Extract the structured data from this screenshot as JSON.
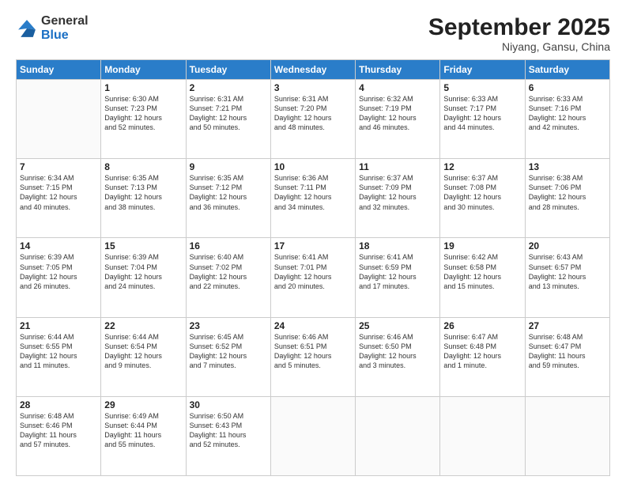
{
  "header": {
    "logo": {
      "line1": "General",
      "line2": "Blue"
    },
    "title": "September 2025",
    "location": "Niyang, Gansu, China"
  },
  "weekdays": [
    "Sunday",
    "Monday",
    "Tuesday",
    "Wednesday",
    "Thursday",
    "Friday",
    "Saturday"
  ],
  "weeks": [
    [
      {
        "day": "",
        "info": ""
      },
      {
        "day": "1",
        "info": "Sunrise: 6:30 AM\nSunset: 7:23 PM\nDaylight: 12 hours\nand 52 minutes."
      },
      {
        "day": "2",
        "info": "Sunrise: 6:31 AM\nSunset: 7:21 PM\nDaylight: 12 hours\nand 50 minutes."
      },
      {
        "day": "3",
        "info": "Sunrise: 6:31 AM\nSunset: 7:20 PM\nDaylight: 12 hours\nand 48 minutes."
      },
      {
        "day": "4",
        "info": "Sunrise: 6:32 AM\nSunset: 7:19 PM\nDaylight: 12 hours\nand 46 minutes."
      },
      {
        "day": "5",
        "info": "Sunrise: 6:33 AM\nSunset: 7:17 PM\nDaylight: 12 hours\nand 44 minutes."
      },
      {
        "day": "6",
        "info": "Sunrise: 6:33 AM\nSunset: 7:16 PM\nDaylight: 12 hours\nand 42 minutes."
      }
    ],
    [
      {
        "day": "7",
        "info": "Sunrise: 6:34 AM\nSunset: 7:15 PM\nDaylight: 12 hours\nand 40 minutes."
      },
      {
        "day": "8",
        "info": "Sunrise: 6:35 AM\nSunset: 7:13 PM\nDaylight: 12 hours\nand 38 minutes."
      },
      {
        "day": "9",
        "info": "Sunrise: 6:35 AM\nSunset: 7:12 PM\nDaylight: 12 hours\nand 36 minutes."
      },
      {
        "day": "10",
        "info": "Sunrise: 6:36 AM\nSunset: 7:11 PM\nDaylight: 12 hours\nand 34 minutes."
      },
      {
        "day": "11",
        "info": "Sunrise: 6:37 AM\nSunset: 7:09 PM\nDaylight: 12 hours\nand 32 minutes."
      },
      {
        "day": "12",
        "info": "Sunrise: 6:37 AM\nSunset: 7:08 PM\nDaylight: 12 hours\nand 30 minutes."
      },
      {
        "day": "13",
        "info": "Sunrise: 6:38 AM\nSunset: 7:06 PM\nDaylight: 12 hours\nand 28 minutes."
      }
    ],
    [
      {
        "day": "14",
        "info": "Sunrise: 6:39 AM\nSunset: 7:05 PM\nDaylight: 12 hours\nand 26 minutes."
      },
      {
        "day": "15",
        "info": "Sunrise: 6:39 AM\nSunset: 7:04 PM\nDaylight: 12 hours\nand 24 minutes."
      },
      {
        "day": "16",
        "info": "Sunrise: 6:40 AM\nSunset: 7:02 PM\nDaylight: 12 hours\nand 22 minutes."
      },
      {
        "day": "17",
        "info": "Sunrise: 6:41 AM\nSunset: 7:01 PM\nDaylight: 12 hours\nand 20 minutes."
      },
      {
        "day": "18",
        "info": "Sunrise: 6:41 AM\nSunset: 6:59 PM\nDaylight: 12 hours\nand 17 minutes."
      },
      {
        "day": "19",
        "info": "Sunrise: 6:42 AM\nSunset: 6:58 PM\nDaylight: 12 hours\nand 15 minutes."
      },
      {
        "day": "20",
        "info": "Sunrise: 6:43 AM\nSunset: 6:57 PM\nDaylight: 12 hours\nand 13 minutes."
      }
    ],
    [
      {
        "day": "21",
        "info": "Sunrise: 6:44 AM\nSunset: 6:55 PM\nDaylight: 12 hours\nand 11 minutes."
      },
      {
        "day": "22",
        "info": "Sunrise: 6:44 AM\nSunset: 6:54 PM\nDaylight: 12 hours\nand 9 minutes."
      },
      {
        "day": "23",
        "info": "Sunrise: 6:45 AM\nSunset: 6:52 PM\nDaylight: 12 hours\nand 7 minutes."
      },
      {
        "day": "24",
        "info": "Sunrise: 6:46 AM\nSunset: 6:51 PM\nDaylight: 12 hours\nand 5 minutes."
      },
      {
        "day": "25",
        "info": "Sunrise: 6:46 AM\nSunset: 6:50 PM\nDaylight: 12 hours\nand 3 minutes."
      },
      {
        "day": "26",
        "info": "Sunrise: 6:47 AM\nSunset: 6:48 PM\nDaylight: 12 hours\nand 1 minute."
      },
      {
        "day": "27",
        "info": "Sunrise: 6:48 AM\nSunset: 6:47 PM\nDaylight: 11 hours\nand 59 minutes."
      }
    ],
    [
      {
        "day": "28",
        "info": "Sunrise: 6:48 AM\nSunset: 6:46 PM\nDaylight: 11 hours\nand 57 minutes."
      },
      {
        "day": "29",
        "info": "Sunrise: 6:49 AM\nSunset: 6:44 PM\nDaylight: 11 hours\nand 55 minutes."
      },
      {
        "day": "30",
        "info": "Sunrise: 6:50 AM\nSunset: 6:43 PM\nDaylight: 11 hours\nand 52 minutes."
      },
      {
        "day": "",
        "info": ""
      },
      {
        "day": "",
        "info": ""
      },
      {
        "day": "",
        "info": ""
      },
      {
        "day": "",
        "info": ""
      }
    ]
  ]
}
